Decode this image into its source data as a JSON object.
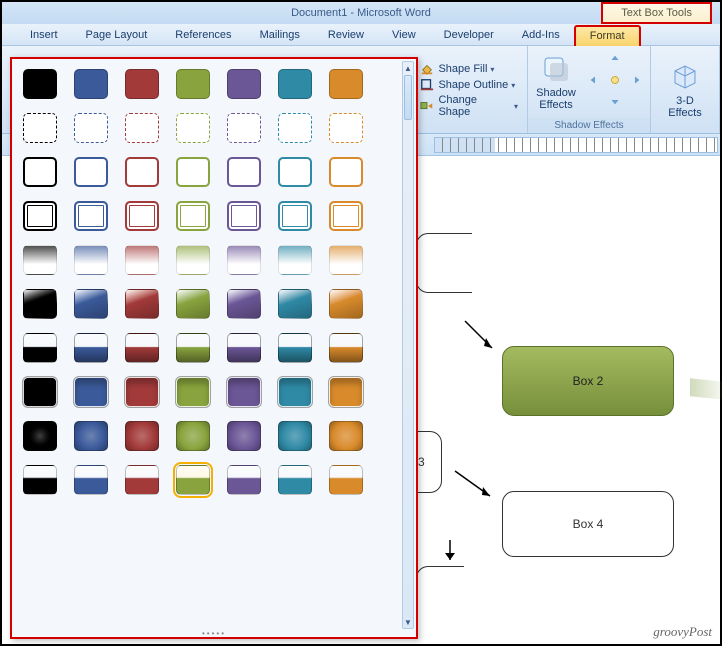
{
  "window": {
    "title": "Document1 - Microsoft Word",
    "contextual_tab": "Text Box Tools"
  },
  "tabs": {
    "insert": "Insert",
    "page_layout": "Page Layout",
    "references": "References",
    "mailings": "Mailings",
    "review": "Review",
    "view": "View",
    "developer": "Developer",
    "addins": "Add-Ins",
    "format": "Format"
  },
  "ribbon": {
    "shape_fill": "Shape Fill",
    "shape_outline": "Shape Outline",
    "change_shape": "Change Shape",
    "shadow_effects": "Shadow\nEffects",
    "threed_effects": "3-D\nEffects",
    "shadow_group": "Shadow Effects"
  },
  "palette": {
    "colors": [
      "#000000",
      "#3b5a9a",
      "#a23a3a",
      "#89a43e",
      "#6b5696",
      "#2f8aa6",
      "#d98b2b"
    ],
    "rows": [
      "solid",
      "dashed",
      "outline",
      "double",
      "grad-light",
      "shiny",
      "glossy-dark",
      "beveled",
      "pillow",
      "glossy-top"
    ],
    "selected": {
      "row": 9,
      "col": 3
    }
  },
  "document": {
    "box2": "Box 2",
    "box4": "Box 4",
    "partial_text": "3"
  },
  "watermark": "groovyPost",
  "chart_data": null
}
